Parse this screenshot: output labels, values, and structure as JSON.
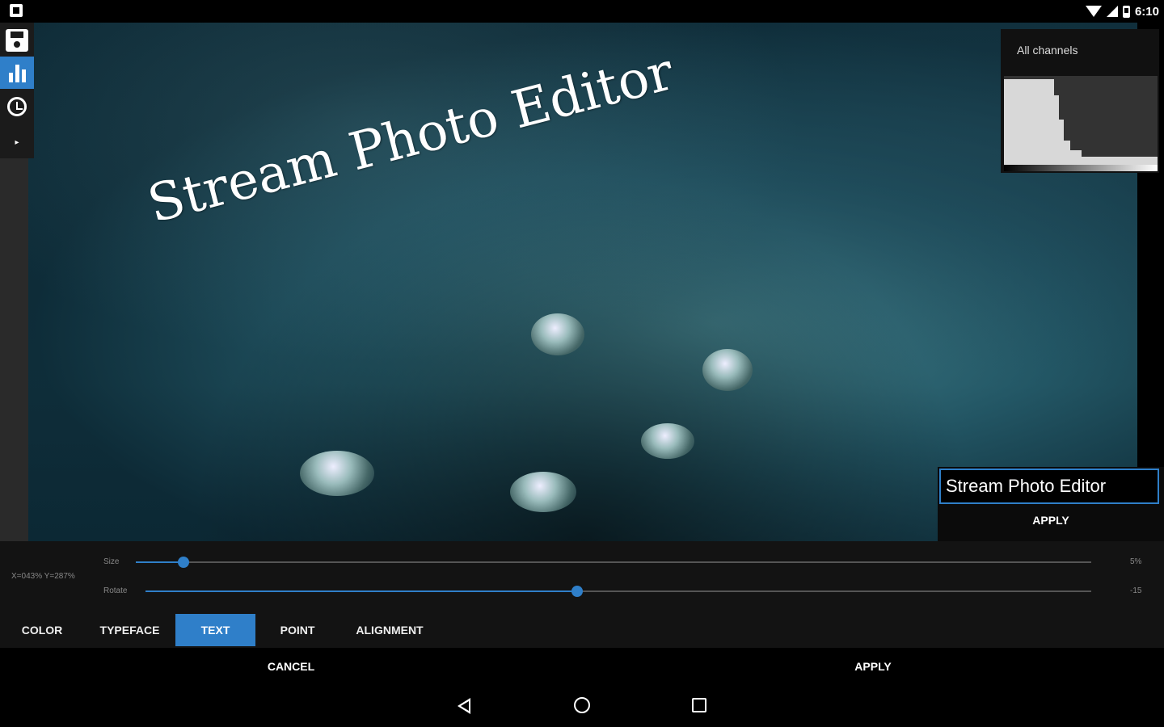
{
  "status_bar": {
    "time": "6:10"
  },
  "image_overlay": {
    "text": "Stream Photo Editor"
  },
  "histogram": {
    "label": "All channels"
  },
  "text_editor": {
    "value": "Stream Photo Editor",
    "apply_label": "APPLY"
  },
  "controls": {
    "coords": "X=043%  Y=287%",
    "size": {
      "label": "Size",
      "value_text": "5%",
      "level": 0.05
    },
    "rotate": {
      "label": "Rotate",
      "value_text": "-15",
      "level": 0.456
    }
  },
  "tabs": [
    {
      "label": "COLOR",
      "active": false
    },
    {
      "label": "TYPEFACE",
      "active": false
    },
    {
      "label": "TEXT",
      "active": true
    },
    {
      "label": "POINT",
      "active": false
    },
    {
      "label": "ALIGNMENT",
      "active": false
    }
  ],
  "actions": {
    "cancel_label": "CANCEL",
    "apply_label": "APPLY"
  },
  "colors": {
    "accent": "#2f7fc9",
    "background": "#000000",
    "panel": "#131313"
  },
  "icons": {
    "toolbar": [
      "save-icon",
      "histogram-icon",
      "history-icon",
      "expand-arrow-icon"
    ],
    "navigation": [
      "nav-back-icon",
      "nav-home-icon",
      "nav-recents-icon"
    ]
  }
}
